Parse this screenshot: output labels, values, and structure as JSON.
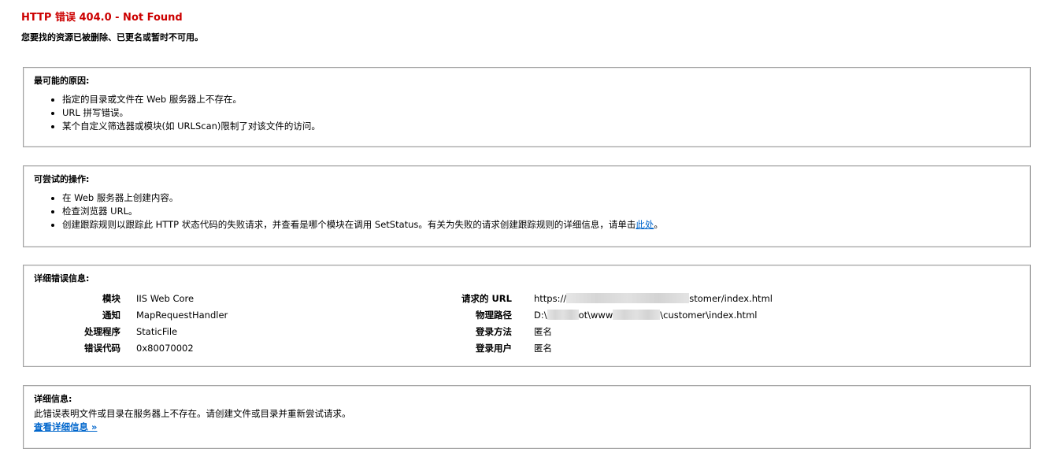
{
  "header": {
    "title": "HTTP 错误 404.0 - Not Found",
    "subtitle": "您要找的资源已被删除、已更名或暂时不可用。"
  },
  "causes": {
    "heading": "最可能的原因:",
    "items": [
      "指定的目录或文件在 Web 服务器上不存在。",
      "URL 拼写错误。",
      "某个自定义筛选器或模块(如 URLScan)限制了对该文件的访问。"
    ]
  },
  "actions": {
    "heading": "可尝试的操作:",
    "items": [
      "在 Web 服务器上创建内容。",
      "检查浏览器 URL。"
    ],
    "tracing_text": "创建跟踪规则以跟踪此 HTTP 状态代码的失败请求，并查看是哪个模块在调用 SetStatus。有关为失败的请求创建跟踪规则的详细信息，请单击",
    "tracing_link": "此处",
    "tracing_end": "。"
  },
  "details": {
    "heading": "详细错误信息:",
    "left": [
      {
        "label": "模块",
        "value": "IIS Web Core"
      },
      {
        "label": "通知",
        "value": "MapRequestHandler"
      },
      {
        "label": "处理程序",
        "value": "StaticFile"
      },
      {
        "label": "错误代码",
        "value": "0x80070002"
      }
    ],
    "right": {
      "url_label": "请求的 URL",
      "url_prefix": "https://",
      "url_suffix": "stomer/index.html",
      "path_label": "物理路径",
      "path_prefix": "D:\\",
      "path_mid": "ot\\www",
      "path_suffix": "\\customer\\index.html",
      "logon_method_label": "登录方法",
      "logon_method_value": "匿名",
      "logon_user_label": "登录用户",
      "logon_user_value": "匿名"
    }
  },
  "info": {
    "heading": "详细信息:",
    "text": "此错误表明文件或目录在服务器上不存在。请创建文件或目录并重新尝试请求。",
    "link": "查看详细信息 »"
  },
  "colors": {
    "title": "#cc0000",
    "link": "#0066cc",
    "border": "#a0a0a0"
  }
}
